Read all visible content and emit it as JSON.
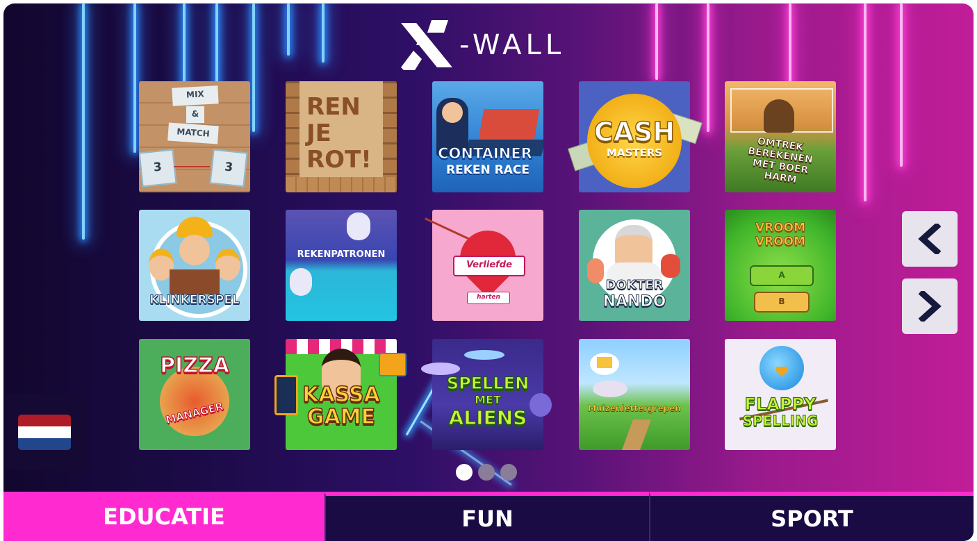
{
  "logo": {
    "text": "-WALL"
  },
  "games": [
    {
      "title": "MIX & MATCH",
      "caption": ""
    },
    {
      "title": "REN JE ROT!",
      "caption": ""
    },
    {
      "title": "CONTAINER REKEN RACE",
      "caption": ""
    },
    {
      "title": "CASH MASTERS",
      "caption": ""
    },
    {
      "title": "OMTREK BEREKENEN MET BOER HARM",
      "caption": ""
    },
    {
      "title": "KLINKERSPEL",
      "caption": ""
    },
    {
      "title": "REKENPATRONEN",
      "caption": ""
    },
    {
      "title": "Verliefde harten",
      "caption": ""
    },
    {
      "title": "DOKTER NANDO",
      "caption": ""
    },
    {
      "title": "VROOM VROOM",
      "caption": ""
    },
    {
      "title": "PIZZA MANAGER",
      "caption": ""
    },
    {
      "title": "KASSA GAME",
      "caption": ""
    },
    {
      "title": "SPELLEN MET ALIENS",
      "caption": ""
    },
    {
      "title": "Muizenlettergrepen",
      "caption": ""
    },
    {
      "title": "FLAPPY SPELLING",
      "caption": ""
    }
  ],
  "tile_text": {
    "mix": "MIX",
    "amp": "&",
    "match": "MATCH",
    "three_a": "3",
    "three_b": "3",
    "ren": "REN",
    "je": "JE",
    "rot": "ROT!",
    "container": "CONTAINER",
    "reken_race": "REKEN RACE",
    "cash": "CASH",
    "masters": "MASTERS",
    "omtrek": "OMTREK",
    "berekenen": "BEREKENEN",
    "met_boer": "MET BOER",
    "harm": "HARM",
    "klinkerspel": "KLINKERSPEL",
    "rekenpatronen": "REKENPATRONEN",
    "verliefde": "Verliefde",
    "harten": "harten",
    "dokter": "DOKTER",
    "nando": "NANDO",
    "vroom1": "VROOM",
    "vroom2": "VROOM",
    "opt_a": "A",
    "opt_b": "B",
    "pizza": "PIZZA",
    "manager": "MANAGER",
    "kassa": "KASSA",
    "game": "GAME",
    "spellen": "SPELLEN",
    "met": "MET",
    "aliens": "ALIENS",
    "muizen": "Muizenlettergrepen",
    "flappy": "FLAPPY",
    "spelling": "SPELLING"
  },
  "nav": {
    "prev_icon": "chevron-left-icon",
    "next_icon": "chevron-right-icon"
  },
  "language": {
    "flag": "netherlands-flag-icon"
  },
  "pagination": {
    "pages": 3,
    "current": 1
  },
  "tabs": [
    {
      "label": "EDUCATIE",
      "active": true
    },
    {
      "label": "FUN",
      "active": false
    },
    {
      "label": "SPORT",
      "active": false
    }
  ],
  "colors": {
    "accent": "#ff2bd1",
    "tab_inactive": "#1a0b45",
    "flag_red": "#ae1c28",
    "flag_white": "#ffffff",
    "flag_blue": "#21468b"
  }
}
